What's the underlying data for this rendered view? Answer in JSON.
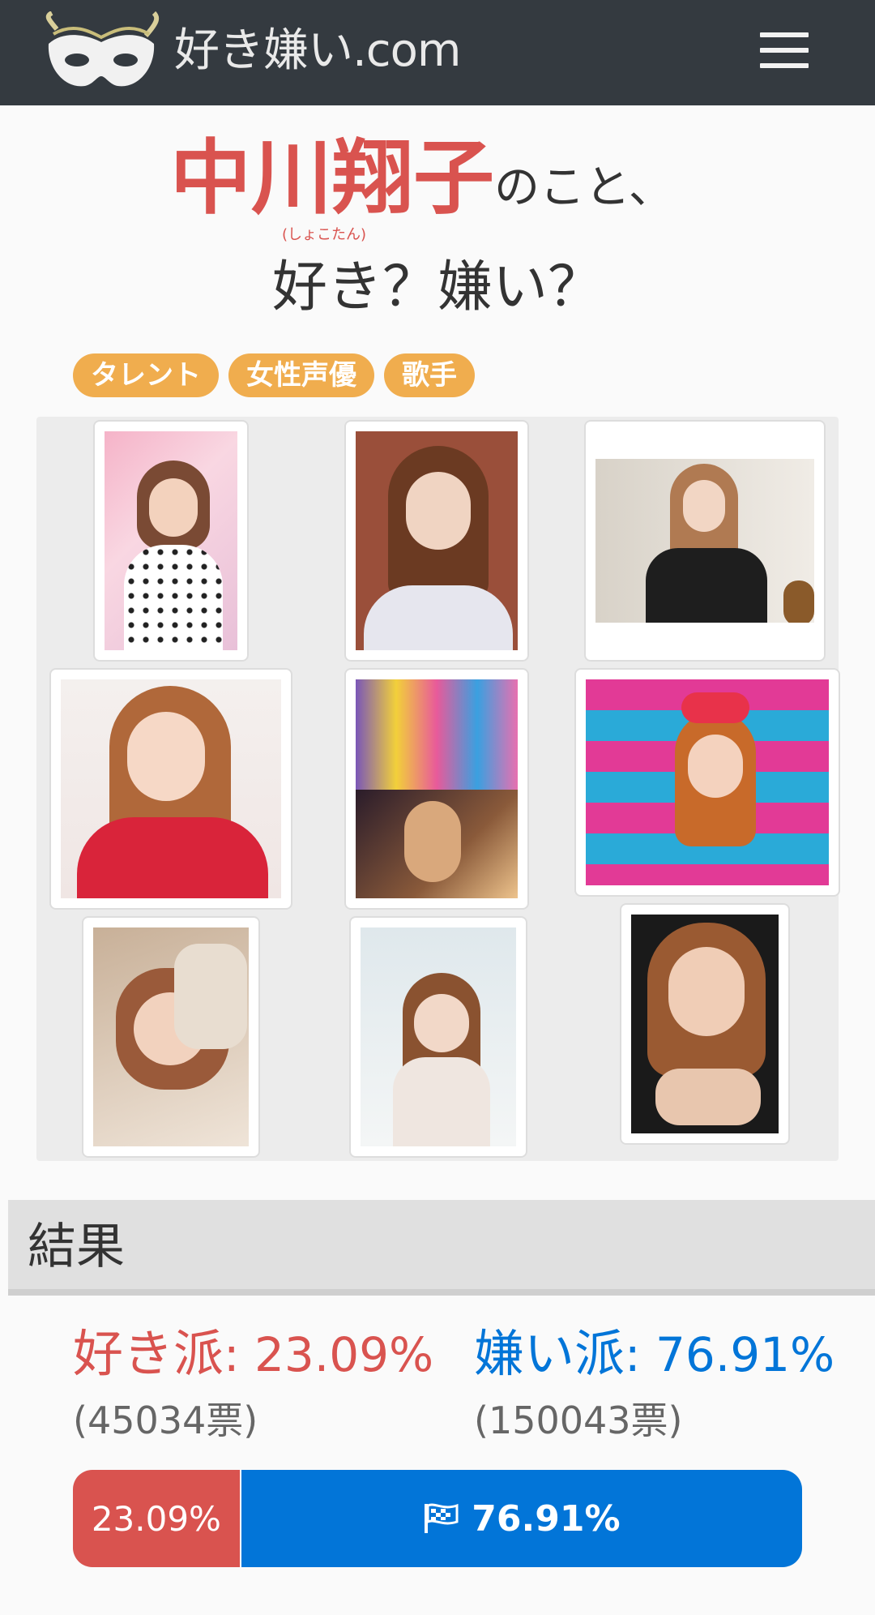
{
  "header": {
    "site_name": "好き嫌い.com",
    "logo_icon": "mask-icon",
    "menu_icon": "hamburger-menu-icon"
  },
  "title": {
    "name": "中川翔子",
    "reading": "(しょこたん)",
    "suffix": "のこと、",
    "question": "好き？嫌い？"
  },
  "tags": [
    "タレント",
    "女性声優",
    "歌手"
  ],
  "gallery": {
    "image_count": 9
  },
  "result": {
    "heading": "結果",
    "like": {
      "label": "好き派",
      "percent_text": ": 23.09%",
      "votes": "(45034票)",
      "percent": 23.09
    },
    "dislike": {
      "label": "嫌い派",
      "percent_text": ": 76.91%",
      "votes": "(150043票)",
      "percent": 76.91
    },
    "bar_like_label": "23.09%",
    "bar_dislike_label": "76.91%",
    "bar_dislike_icon": "flag-icon"
  },
  "colors": {
    "header_bg": "#343a40",
    "like": "#d9534f",
    "dislike": "#0275d8",
    "tag": "#f0ad4e"
  }
}
